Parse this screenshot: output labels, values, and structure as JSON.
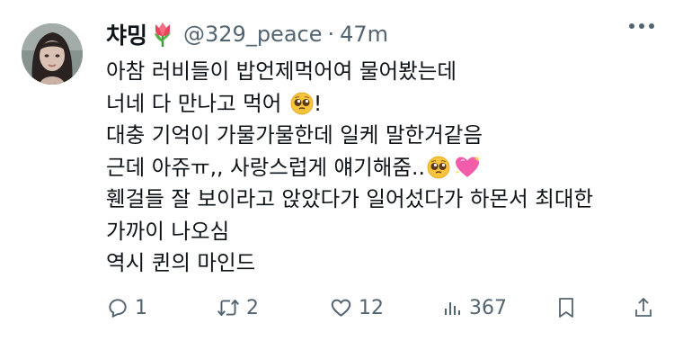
{
  "author": {
    "display_name": "챠밍",
    "handle": "@329_peace",
    "separator": "·",
    "timestamp": "47m"
  },
  "tweet": {
    "lines": [
      "아참 러비들이 밥언제먹어여 물어봤는데",
      "너네 다 만나고 먹어",
      "대충 기억이 가물가물한데 일케 말한거같음",
      "근데 아쥬ㅠ,, 사랑스럽게 얘기해줌..",
      "휀걸들 잘 보이라고 앉았다가 일어섰다가 하몬서 최대한",
      "가까이 나오심",
      "역시 퀸의 마인드"
    ],
    "line2_suffix": "!"
  },
  "actions": {
    "replies": "1",
    "retweets": "2",
    "likes": "12",
    "views": "367"
  },
  "icons": {
    "tulip": "tulip-emoji-icon",
    "pleading": "pleading-face-emoji-icon",
    "heart": "sparkling-heart-emoji-icon"
  },
  "colors": {
    "text": "#0f1419",
    "secondary": "#536471"
  }
}
